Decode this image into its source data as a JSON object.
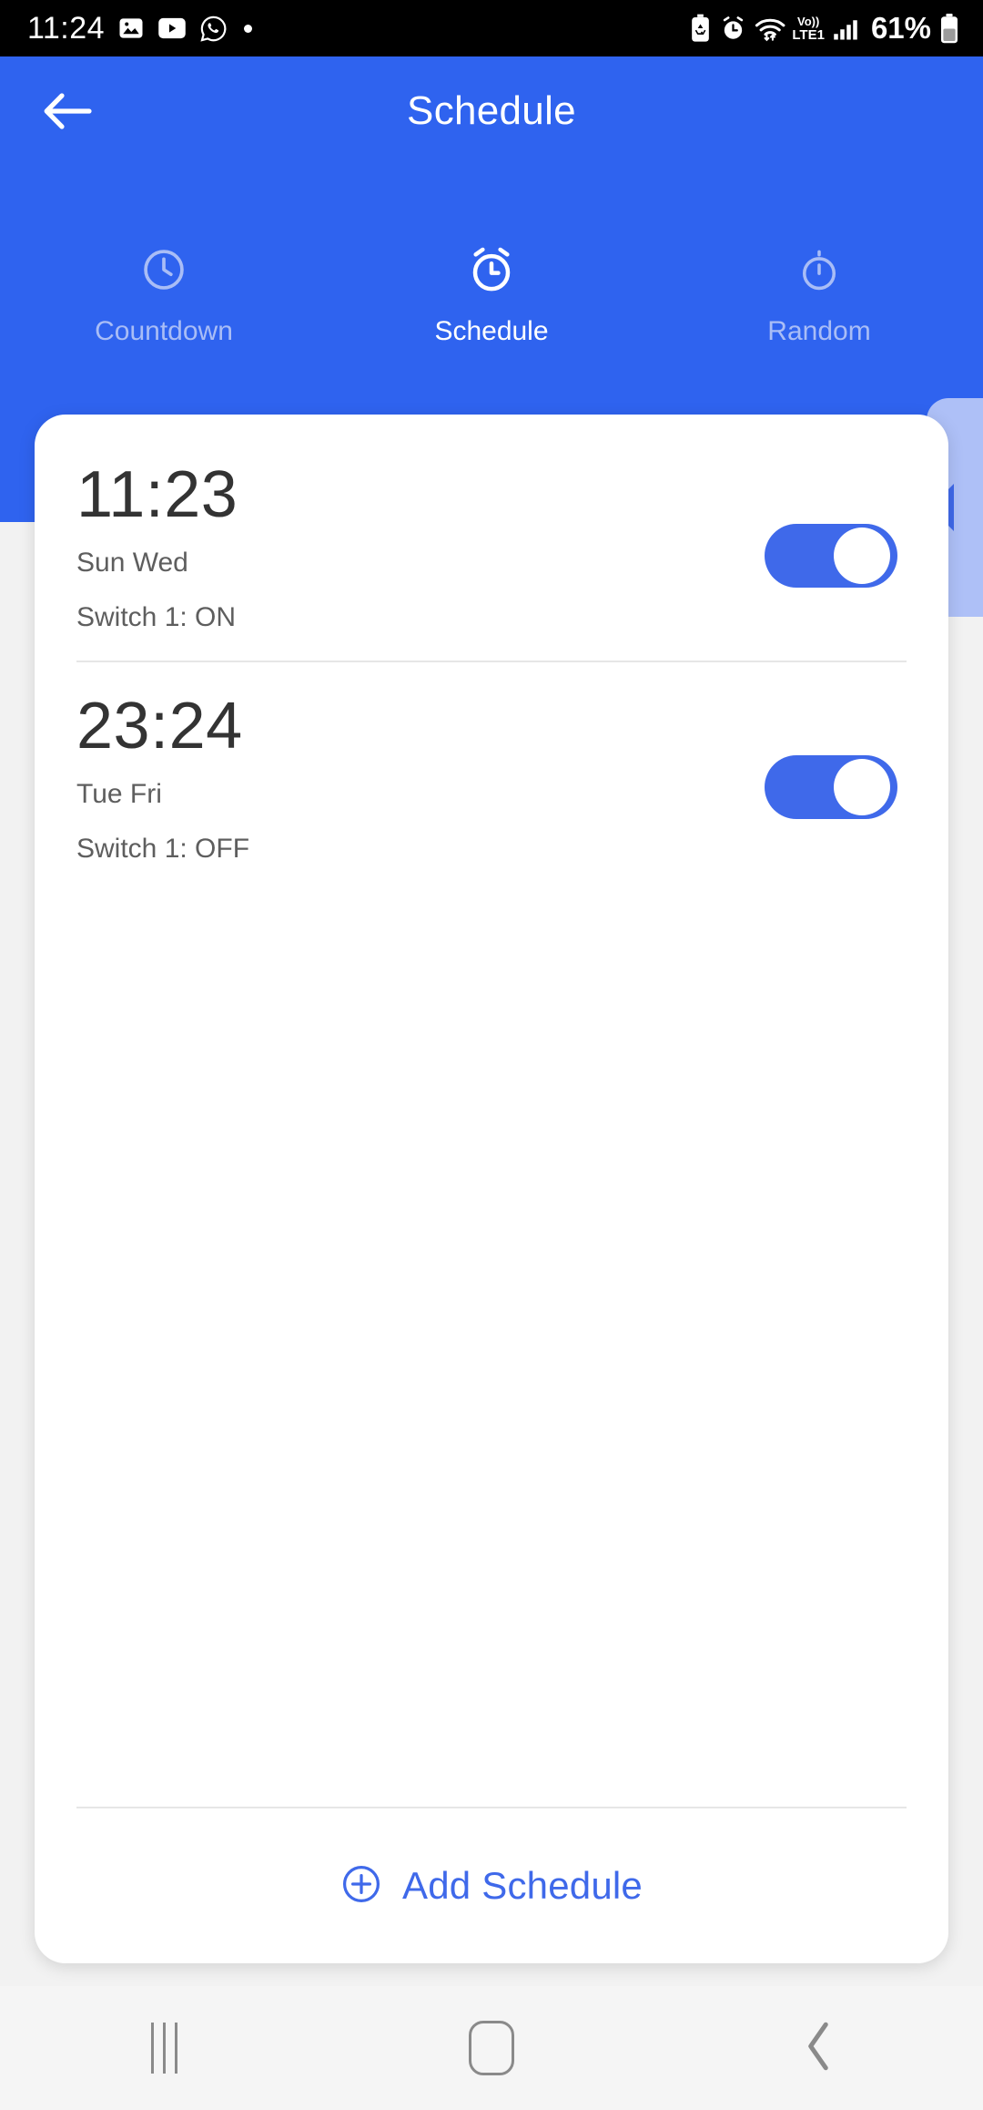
{
  "status_bar": {
    "clock": "11:24",
    "battery_percent": "61%",
    "network_label_top": "Vo))",
    "network_label_bottom": "LTE1",
    "left_icons": [
      "photos-icon",
      "youtube-icon",
      "whatsapp-icon",
      "dot-indicator-icon"
    ],
    "right_icons": [
      "battery-saver-icon",
      "alarm-icon",
      "wifi-icon",
      "volte-icon",
      "signal-bars-icon",
      "battery-icon"
    ]
  },
  "header": {
    "title": "Schedule",
    "back_icon": "arrow-left-icon",
    "background_color": "#2f63ef"
  },
  "tabs": [
    {
      "label": "Countdown",
      "icon": "clock-icon",
      "active": false
    },
    {
      "label": "Schedule",
      "icon": "alarm-clock-icon",
      "active": true
    },
    {
      "label": "Random",
      "icon": "stopwatch-icon",
      "active": false
    }
  ],
  "side_handle": {
    "icon": "triangle-left-icon",
    "color": "#aec0f7",
    "arrow_color": "#3f69ea"
  },
  "schedules": [
    {
      "time": "11:23",
      "days": "Sun Wed",
      "action": "Switch 1: ON",
      "enabled": true
    },
    {
      "time": "23:24",
      "days": "Tue Fri",
      "action": "Switch 1: OFF",
      "enabled": true
    }
  ],
  "add_button": {
    "label": "Add Schedule",
    "icon": "plus-circle-icon",
    "color": "#3f69ea"
  },
  "nav_bar": {
    "recents": "recents-icon",
    "home": "home-icon",
    "back": "back-icon"
  },
  "colors": {
    "accent": "#3f69ea",
    "header": "#2f63ef",
    "tab_inactive": "#a9bdf6",
    "page_bg": "#f2f2f2",
    "card": "#ffffff"
  }
}
